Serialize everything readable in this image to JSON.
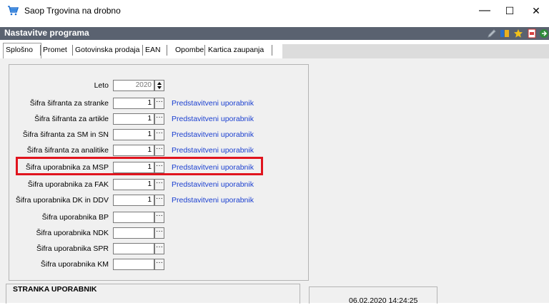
{
  "window": {
    "title": "Saop Trgovina na drobno",
    "controls": {
      "minimize": "—",
      "maximize": "☐",
      "close": "✕"
    }
  },
  "header": {
    "title": "Nastavitve programa",
    "icons": [
      "pencil-icon",
      "columns-icon",
      "star-icon",
      "document-icon",
      "exit-icon"
    ]
  },
  "tabs": [
    {
      "label": "Splošno",
      "active": true
    },
    {
      "label": "Promet"
    },
    {
      "label": "Gotovinska prodaja"
    },
    {
      "label": "EAN"
    },
    {
      "label": "Opombe"
    },
    {
      "label": "Kartica zaupanja"
    }
  ],
  "form": {
    "leto": {
      "label": "Leto",
      "value": "2020"
    },
    "rows": [
      {
        "label": "Šifra šifranta za stranke",
        "value": "1",
        "link": "Predstavitveni uporabnik"
      },
      {
        "label": "Šifra šifranta za artikle",
        "value": "1",
        "link": "Predstavitveni uporabnik"
      },
      {
        "label": "Šifra šifranta za SM in SN",
        "value": "1",
        "link": "Predstavitveni uporabnik"
      },
      {
        "label": "Šifra šifranta za analitike",
        "value": "1",
        "link": "Predstavitveni uporabnik"
      },
      {
        "label": "Šifra uporabnika za MSP",
        "value": "1",
        "link": "Predstavitveni uporabnik"
      },
      {
        "label": "Šifra uporabnika za FAK",
        "value": "1",
        "link": "Predstavitveni uporabnik"
      },
      {
        "label": "Šifra uporabnika DK in DDV",
        "value": "1",
        "link": "Predstavitveni uporabnik"
      },
      {
        "label": "Šifra uporabnika BP",
        "value": "",
        "link": ""
      },
      {
        "label": "Šifra uporabnika NDK",
        "value": "",
        "link": ""
      },
      {
        "label": "Šifra uporabnika SPR",
        "value": "",
        "link": ""
      },
      {
        "label": "Šifra uporabnika KM",
        "value": "",
        "link": ""
      }
    ],
    "dots_label": "···"
  },
  "stranka": {
    "title": "STRANKA UPORABNIK",
    "datetime": "06.02.2020 14:24:25"
  },
  "colors": {
    "header_bg": "#5a6270",
    "link": "#1a3fd0",
    "highlight": "#e0141e"
  }
}
